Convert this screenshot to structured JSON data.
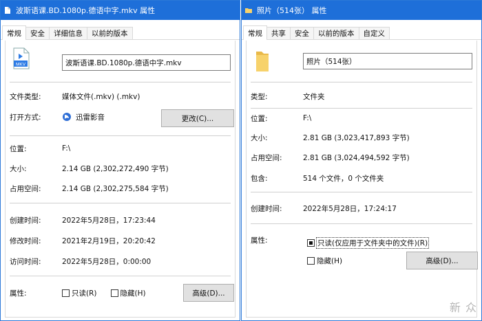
{
  "left": {
    "title": "波斯语课.BD.1080p.德语中字.mkv 属性",
    "tabs": [
      "常规",
      "安全",
      "详细信息",
      "以前的版本"
    ],
    "file_name": "波斯语课.BD.1080p.德语中字.mkv",
    "file_icon_label": "MKV",
    "type_label": "文件类型:",
    "type_value": "媒体文件(.mkv) (.mkv)",
    "open_with_label": "打开方式:",
    "open_with_value": "迅雷影音",
    "change_button": "更改(C)...",
    "location_label": "位置:",
    "location_value": "F:\\",
    "size_label": "大小:",
    "size_value": "2.14 GB (2,302,272,490 字节)",
    "disk_size_label": "占用空间:",
    "disk_size_value": "2.14 GB (2,302,275,584 字节)",
    "created_label": "创建时间:",
    "created_value": "2022年5月28日，17:23:44",
    "modified_label": "修改时间:",
    "modified_value": "2021年2月19日，20:20:42",
    "accessed_label": "访问时间:",
    "accessed_value": "2022年5月28日，0:00:00",
    "attributes_label": "属性:",
    "readonly_label": "只读(R)",
    "hidden_label": "隐藏(H)",
    "advanced_button": "高级(D)..."
  },
  "right": {
    "title": "照片（514张） 属性",
    "tabs": [
      "常规",
      "共享",
      "安全",
      "以前的版本",
      "自定义"
    ],
    "folder_name": "照片（514张）",
    "type_label": "类型:",
    "type_value": "文件夹",
    "location_label": "位置:",
    "location_value": "F:\\",
    "size_label": "大小:",
    "size_value": "2.81 GB (3,023,417,893 字节)",
    "disk_size_label": "占用空间:",
    "disk_size_value": "2.81 GB (3,024,494,592 字节)",
    "contains_label": "包含:",
    "contains_value": "514 个文件，0 个文件夹",
    "created_label": "创建时间:",
    "created_value": "2022年5月28日，17:24:17",
    "attributes_label": "属性:",
    "readonly_label": "只读(仅应用于文件夹中的文件)(R)",
    "hidden_label": "隐藏(H)",
    "advanced_button": "高级(D)..."
  },
  "watermark": "新 众",
  "colors": {
    "title_bar": "#1e6fd9",
    "border": "#2b78d8",
    "folder": "#f7d26b"
  }
}
